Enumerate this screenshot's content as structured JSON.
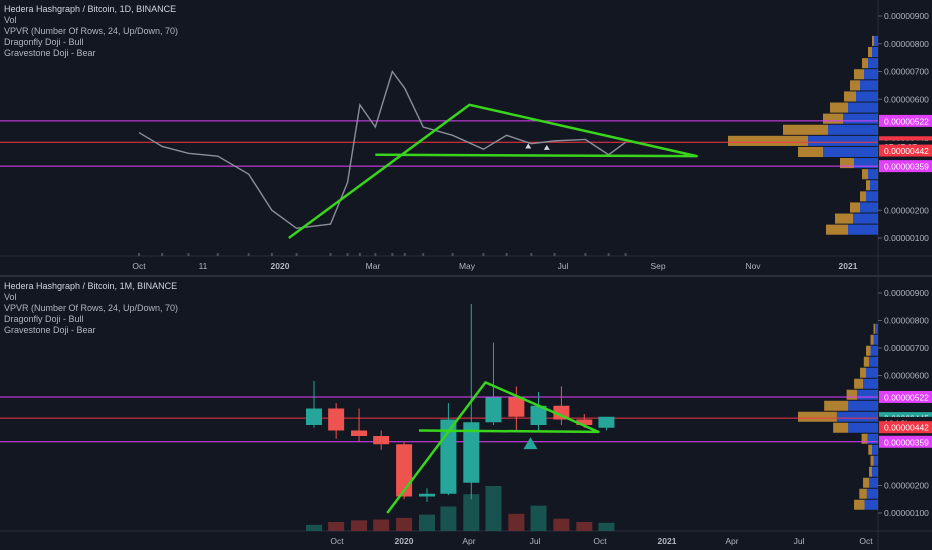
{
  "chart_data": [
    {
      "type": "candlestick",
      "title": "Hedera Hashgraph / Bitcoin, 1D, BINANCE",
      "indicators": [
        "Vol",
        "VPVR (Number Of Rows, 24, Up/Down, 70)",
        "Dragonfly Doji - Bull",
        "Gravestone Doji - Bear"
      ],
      "x_tick_labels": [
        "Oct",
        "11",
        "2020",
        "Mar",
        "May",
        "Jul",
        "Sep",
        "Nov",
        "2021"
      ],
      "y_tick_labels": [
        "0.00000900",
        "0.00000800",
        "0.00000700",
        "0.00000600",
        "0.00000200",
        "0.00000100"
      ],
      "ylim": [
        4e-07,
        9.4e-07
      ],
      "price_line_labels": [
        {
          "text": "0.00000522",
          "value": 5.22e-06,
          "kind": "magenta"
        },
        {
          "text": "0.00000445",
          "value": 4.45e-06,
          "kind": "red"
        },
        {
          "text": "07:47:07",
          "value": 4.3e-06,
          "kind": "timer"
        },
        {
          "text": "0.00000442",
          "value": 4.15e-06,
          "kind": "redbox"
        },
        {
          "text": "0.00000359",
          "value": 3.59e-06,
          "kind": "magenta"
        }
      ],
      "path_samples": [
        {
          "d": "2019-09-30",
          "v": 4.8e-06
        },
        {
          "d": "2019-10-15",
          "v": 4.3e-06
        },
        {
          "d": "2019-11-01",
          "v": 4.05e-06
        },
        {
          "d": "2019-11-20",
          "v": 3.95e-06
        },
        {
          "d": "2019-12-10",
          "v": 3.3e-06
        },
        {
          "d": "2019-12-25",
          "v": 2e-06
        },
        {
          "d": "2020-01-10",
          "v": 1.35e-06
        },
        {
          "d": "2020-02-01",
          "v": 1.5e-06
        },
        {
          "d": "2020-02-12",
          "v": 3e-06
        },
        {
          "d": "2020-02-20",
          "v": 5.8e-06
        },
        {
          "d": "2020-03-01",
          "v": 5e-06
        },
        {
          "d": "2020-03-12",
          "v": 7e-06
        },
        {
          "d": "2020-03-20",
          "v": 6.4e-06
        },
        {
          "d": "2020-04-01",
          "v": 5e-06
        },
        {
          "d": "2020-04-20",
          "v": 4.7e-06
        },
        {
          "d": "2020-05-10",
          "v": 4.2e-06
        },
        {
          "d": "2020-05-25",
          "v": 4.7e-06
        },
        {
          "d": "2020-06-10",
          "v": 4.4e-06
        },
        {
          "d": "2020-06-25",
          "v": 4.5e-06
        },
        {
          "d": "2020-07-15",
          "v": 4.55e-06
        },
        {
          "d": "2020-07-30",
          "v": 4e-06
        },
        {
          "d": "2020-08-10",
          "v": 4.45e-06
        }
      ],
      "volume_profile": [
        {
          "price": 1.3e-06,
          "up": 30,
          "down": 22
        },
        {
          "price": 1.7e-06,
          "up": 25,
          "down": 18
        },
        {
          "price": 2.1e-06,
          "up": 18,
          "down": 10
        },
        {
          "price": 2.5e-06,
          "up": 12,
          "down": 6
        },
        {
          "price": 2.9e-06,
          "up": 8,
          "down": 4
        },
        {
          "price": 3.3e-06,
          "up": 10,
          "down": 6
        },
        {
          "price": 3.7e-06,
          "up": 24,
          "down": 14
        },
        {
          "price": 4.1e-06,
          "up": 55,
          "down": 25
        },
        {
          "price": 4.5e-06,
          "up": 70,
          "down": 80
        },
        {
          "price": 4.9e-06,
          "up": 50,
          "down": 45
        },
        {
          "price": 5.3e-06,
          "up": 35,
          "down": 20
        },
        {
          "price": 5.7e-06,
          "up": 30,
          "down": 18
        },
        {
          "price": 6.1e-06,
          "up": 22,
          "down": 12
        },
        {
          "price": 6.5e-06,
          "up": 18,
          "down": 10
        },
        {
          "price": 6.9e-06,
          "up": 14,
          "down": 10
        },
        {
          "price": 7.3e-06,
          "up": 10,
          "down": 6
        },
        {
          "price": 7.7e-06,
          "up": 6,
          "down": 4
        },
        {
          "price": 8.1e-06,
          "up": 4,
          "down": 2
        }
      ],
      "triangle": [
        {
          "d": "2020-01-05",
          "v": 1e-06
        },
        {
          "d": "2020-05-01",
          "v": 5.8e-06
        },
        {
          "d": "2020-09-25",
          "v": 3.95e-06
        },
        {
          "d": "2020-03-01",
          "v": 4e-06
        }
      ],
      "markers": [
        {
          "d": "2020-06-08",
          "v": 4.3e-06,
          "color": "#d1d4dc"
        },
        {
          "d": "2020-06-20",
          "v": 4.25e-06,
          "color": "#d1d4dc"
        }
      ]
    },
    {
      "type": "candlestick",
      "title": "Hedera Hashgraph / Bitcoin, 1M, BINANCE",
      "indicators": [
        "Vol",
        "VPVR (Number Of Rows, 24, Up/Down, 70)",
        "Dragonfly Doji - Bull",
        "Gravestone Doji - Bear"
      ],
      "x_tick_labels": [
        "Oct",
        "2020",
        "Apr",
        "Jul",
        "Oct",
        "2021",
        "Apr",
        "Jul",
        "Oct"
      ],
      "y_tick_labels": [
        "0.00000900",
        "0.00000800",
        "0.00000700",
        "0.00000600",
        "0.00000200",
        "0.00000100"
      ],
      "ylim": [
        4e-07,
        9.4e-07
      ],
      "price_line_labels": [
        {
          "text": "0.00000522",
          "value": 5.22e-06,
          "kind": "magenta"
        },
        {
          "text": "0.00000445",
          "value": 4.45e-06,
          "kind": "teal"
        },
        {
          "text": "16d 8h",
          "value": 4.28e-06,
          "kind": "timer"
        },
        {
          "text": "0.00000442",
          "value": 4.12e-06,
          "kind": "redbox"
        },
        {
          "text": "0.00000359",
          "value": 3.59e-06,
          "kind": "magenta"
        }
      ],
      "candles": [
        {
          "d": "2019-09-01",
          "o": 4.2e-06,
          "h": 5.8e-06,
          "l": 4.1e-06,
          "c": 4.8e-06,
          "vol": 15
        },
        {
          "d": "2019-10-01",
          "o": 4.8e-06,
          "h": 5e-06,
          "l": 3.7e-06,
          "c": 4e-06,
          "vol": 22
        },
        {
          "d": "2019-11-01",
          "o": 4e-06,
          "h": 4.8e-06,
          "l": 3.6e-06,
          "c": 3.8e-06,
          "vol": 26
        },
        {
          "d": "2019-12-01",
          "o": 3.8e-06,
          "h": 4e-06,
          "l": 3.3e-06,
          "c": 3.5e-06,
          "vol": 28
        },
        {
          "d": "2020-01-01",
          "o": 3.5e-06,
          "h": 3.6e-06,
          "l": 1.5e-06,
          "c": 1.6e-06,
          "vol": 32
        },
        {
          "d": "2020-02-01",
          "o": 1.6e-06,
          "h": 1.9e-06,
          "l": 1.4e-06,
          "c": 1.7e-06,
          "vol": 40
        },
        {
          "d": "2020-03-01",
          "o": 1.7e-06,
          "h": 5e-06,
          "l": 1.65e-06,
          "c": 4.4e-06,
          "vol": 60
        },
        {
          "d": "2020-04-01",
          "o": 2.1e-06,
          "h": 8.6e-06,
          "l": 1.5e-06,
          "c": 4.3e-06,
          "vol": 90
        },
        {
          "d": "2020-05-01",
          "o": 4.3e-06,
          "h": 7.2e-06,
          "l": 4.2e-06,
          "c": 5.2e-06,
          "vol": 110
        },
        {
          "d": "2020-06-01",
          "o": 5.2e-06,
          "h": 5.6e-06,
          "l": 4e-06,
          "c": 4.5e-06,
          "vol": 42
        },
        {
          "d": "2020-07-01",
          "o": 4.2e-06,
          "h": 5.4e-06,
          "l": 4e-06,
          "c": 4.9e-06,
          "vol": 62
        },
        {
          "d": "2020-08-01",
          "o": 4.9e-06,
          "h": 5.6e-06,
          "l": 4.2e-06,
          "c": 4.4e-06,
          "vol": 30
        },
        {
          "d": "2020-09-01",
          "o": 4.4e-06,
          "h": 4.6e-06,
          "l": 4.1e-06,
          "c": 4.2e-06,
          "vol": 22
        },
        {
          "d": "2020-10-01",
          "o": 4.1e-06,
          "h": 4.4e-06,
          "l": 4e-06,
          "c": 4.5e-06,
          "vol": 20
        }
      ],
      "volume_profile": [
        {
          "price": 1.3e-06,
          "up": 18,
          "down": 14
        },
        {
          "price": 1.7e-06,
          "up": 15,
          "down": 10
        },
        {
          "price": 2.1e-06,
          "up": 12,
          "down": 8
        },
        {
          "price": 2.5e-06,
          "up": 8,
          "down": 4
        },
        {
          "price": 2.9e-06,
          "up": 6,
          "down": 4
        },
        {
          "price": 3.3e-06,
          "up": 8,
          "down": 5
        },
        {
          "price": 3.7e-06,
          "up": 14,
          "down": 8
        },
        {
          "price": 4.1e-06,
          "up": 40,
          "down": 20
        },
        {
          "price": 4.5e-06,
          "up": 55,
          "down": 52
        },
        {
          "price": 4.9e-06,
          "up": 40,
          "down": 32
        },
        {
          "price": 5.3e-06,
          "up": 28,
          "down": 14
        },
        {
          "price": 5.7e-06,
          "up": 20,
          "down": 12
        },
        {
          "price": 6.1e-06,
          "up": 16,
          "down": 8
        },
        {
          "price": 6.5e-06,
          "up": 12,
          "down": 7
        },
        {
          "price": 6.9e-06,
          "up": 10,
          "down": 6
        },
        {
          "price": 7.3e-06,
          "up": 6,
          "down": 4
        },
        {
          "price": 7.7e-06,
          "up": 4,
          "down": 2
        }
      ],
      "triangle": [
        {
          "d": "2019-12-20",
          "v": 1e-06
        },
        {
          "d": "2020-05-01",
          "v": 5.75e-06
        },
        {
          "d": "2020-10-01",
          "v": 3.95e-06
        },
        {
          "d": "2020-02-01",
          "v": 4e-06
        }
      ],
      "markers": [
        {
          "d": "2020-07-01",
          "v": 3.5e-06,
          "color": "#26a69a"
        }
      ]
    }
  ]
}
